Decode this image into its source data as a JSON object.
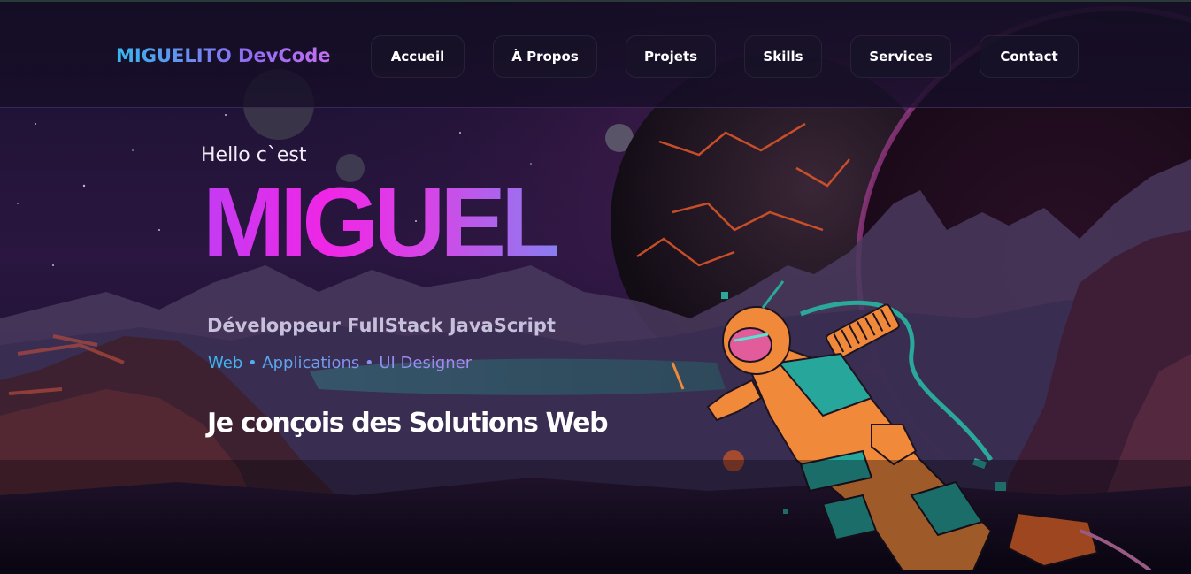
{
  "header": {
    "brand": "MIGUELITO DevCode",
    "nav": [
      {
        "label": "Accueil"
      },
      {
        "label": "À Propos"
      },
      {
        "label": "Projets"
      },
      {
        "label": "Skills"
      },
      {
        "label": "Services"
      },
      {
        "label": "Contact"
      }
    ]
  },
  "hero": {
    "greeting": "Hello c`est",
    "name": "MIGUEL",
    "role": "Développeur FullStack JavaScript",
    "tags": "Web • Applications • UI Designer",
    "slogan": "Je conçois des Solutions Web"
  },
  "illustration": {
    "subject": "astronaut-icon",
    "scene": "alien-planet-background"
  },
  "colors": {
    "accent_pink": "#f026e6",
    "accent_purple": "#8a7df0",
    "accent_blue": "#38b6f0",
    "background": "#0b0716"
  }
}
